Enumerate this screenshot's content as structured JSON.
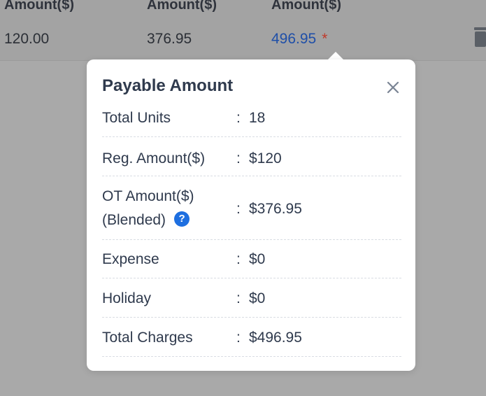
{
  "table": {
    "headers": [
      "Amount($)",
      "Amount($)",
      "Amount($)"
    ],
    "row": {
      "reg_amount": "120.00",
      "ot_amount": "376.95",
      "total": "496.95",
      "required_marker": "*"
    }
  },
  "popover": {
    "title": "Payable Amount",
    "close_icon": "close-icon",
    "rows": [
      {
        "label": "Total Units",
        "colon": ":",
        "value": "18"
      },
      {
        "label": "Reg. Amount($)",
        "colon": ":",
        "value": "$120"
      },
      {
        "label_line1": "OT Amount($)",
        "label_line2": "(Blended)",
        "help_icon": "?",
        "colon": ":",
        "value": "$376.95"
      },
      {
        "label": "Expense",
        "colon": ":",
        "value": "$0"
      },
      {
        "label": "Holiday",
        "colon": ":",
        "value": "$0"
      },
      {
        "label": "Total Charges",
        "colon": ":",
        "value": "$496.95"
      }
    ]
  },
  "colors": {
    "overlay": "#a9a9a9",
    "link": "#1f4fa8",
    "help_badge": "#1e6fe0",
    "required": "#c03a2b"
  }
}
